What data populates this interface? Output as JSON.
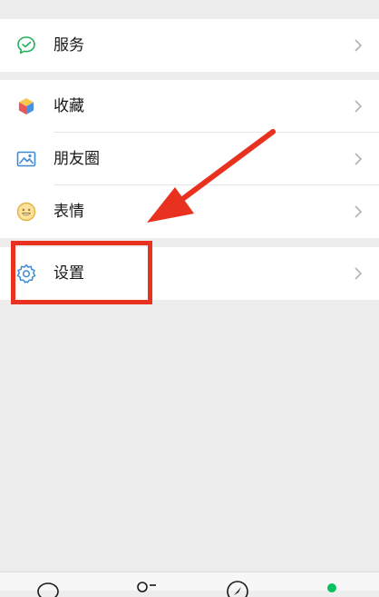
{
  "menu": {
    "services": {
      "label": "服务",
      "icon": "services-icon"
    },
    "favorites": {
      "label": "收藏",
      "icon": "favorites-icon"
    },
    "moments": {
      "label": "朋友圈",
      "icon": "moments-icon"
    },
    "stickers": {
      "label": "表情",
      "icon": "stickers-icon"
    },
    "settings": {
      "label": "设置",
      "icon": "settings-icon"
    }
  },
  "colors": {
    "background": "#ededed",
    "row_bg": "#ffffff",
    "services_green": "#20b15a",
    "annotation_red": "#e8321f",
    "chevron": "#b2b2b2",
    "active_tab": "#07c160"
  },
  "tabbar": {
    "tabs": [
      {
        "icon": "chats-tab-icon"
      },
      {
        "icon": "contacts-tab-icon"
      },
      {
        "icon": "discover-tab-icon"
      },
      {
        "icon": "me-tab-icon",
        "active": true
      }
    ]
  }
}
